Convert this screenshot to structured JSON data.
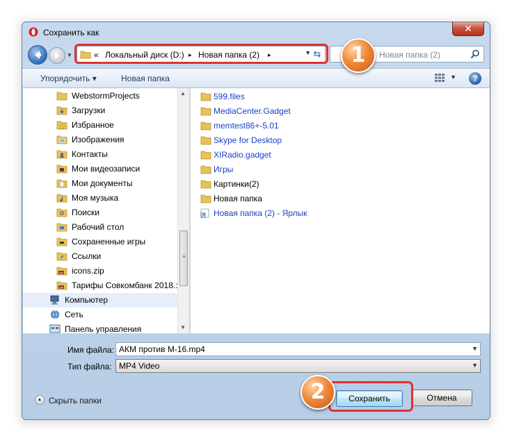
{
  "window": {
    "title": "Сохранить как",
    "close_symbol": "✕"
  },
  "address_bar": {
    "prefix": "«",
    "segments": [
      "Локальный диск (D:)",
      "Новая папка (2)"
    ],
    "separator": "▸"
  },
  "search": {
    "placeholder": "Новая папка (2)"
  },
  "toolbar": {
    "organize_label": "Упорядочить ▾",
    "new_folder_label": "Новая папка",
    "help_symbol": "?"
  },
  "nav_pane": {
    "items": [
      {
        "label": "WebstormProjects",
        "icon": "folder-icon"
      },
      {
        "label": "Загрузки",
        "icon": "downloads-folder-icon"
      },
      {
        "label": "Избранное",
        "icon": "favorites-folder-icon"
      },
      {
        "label": "Изображения",
        "icon": "pictures-folder-icon"
      },
      {
        "label": "Контакты",
        "icon": "contacts-folder-icon"
      },
      {
        "label": "Мои видеозаписи",
        "icon": "videos-folder-icon"
      },
      {
        "label": "Мои документы",
        "icon": "documents-folder-icon"
      },
      {
        "label": "Моя музыка",
        "icon": "music-folder-icon"
      },
      {
        "label": "Поиски",
        "icon": "searches-folder-icon"
      },
      {
        "label": "Рабочий стол",
        "icon": "desktop-folder-icon"
      },
      {
        "label": "Сохраненные игры",
        "icon": "saved-games-folder-icon"
      },
      {
        "label": "Ссылки",
        "icon": "links-folder-icon"
      },
      {
        "label": "icons.zip",
        "icon": "zip-archive-icon"
      },
      {
        "label": "Тарифы Совкомбанк 2018.:",
        "icon": "zip-archive-icon"
      },
      {
        "label": "Компьютер",
        "icon": "computer-icon"
      },
      {
        "label": "Сеть",
        "icon": "network-icon"
      },
      {
        "label": "Панель управления",
        "icon": "control-panel-icon"
      }
    ]
  },
  "file_list": {
    "items": [
      {
        "label": "599.files",
        "color": "#1a3fc7"
      },
      {
        "label": "MediaCenter.Gadget",
        "color": "#1a3fc7"
      },
      {
        "label": "memtest86+-5.01",
        "color": "#1a3fc7"
      },
      {
        "label": "Skype for Desktop",
        "color": "#1a3fc7"
      },
      {
        "label": "XIRadio.gadget",
        "color": "#1a3fc7"
      },
      {
        "label": "Игры",
        "color": "#1a3fc7"
      },
      {
        "label": "Картинки(2)",
        "color": "#000000"
      },
      {
        "label": "Новая папка",
        "color": "#000000"
      },
      {
        "label": "Новая папка (2) - Ярлык",
        "color": "#1a3fc7"
      }
    ]
  },
  "form": {
    "filename_label": "Имя файла:",
    "filename_value": "АКМ против М-16.mp4",
    "filetype_label": "Тип файла:",
    "filetype_value": "MP4 Video"
  },
  "footer": {
    "hide_folders_label": "Скрыть папки",
    "save_label": "Сохранить",
    "cancel_label": "Отмена"
  },
  "annotations": {
    "step1": "1",
    "step2": "2",
    "highlight_color": "#e03030",
    "badge_color": "#f08a3a"
  }
}
